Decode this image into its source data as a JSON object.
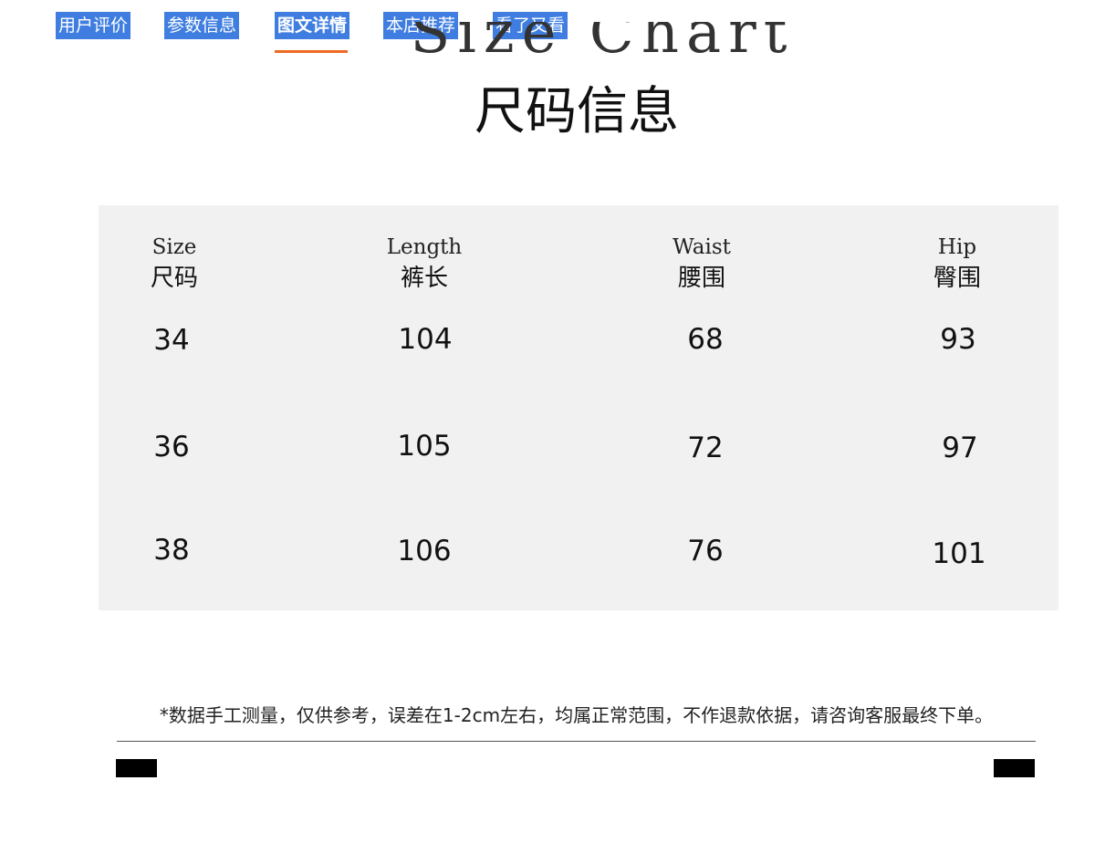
{
  "tabs": [
    {
      "label": "用户评价",
      "active": false
    },
    {
      "label": "参数信息",
      "active": false
    },
    {
      "label": "图文详情",
      "active": true
    },
    {
      "label": "本店推荐",
      "active": false
    },
    {
      "label": "看了又看",
      "active": false
    }
  ],
  "colors": {
    "tab_background": "#3f7ee0",
    "tab_text": "#ffffff",
    "active_underline": "#ef6a22",
    "chart_background": "#f1f1f1"
  },
  "heading": {
    "english": "Size Chart",
    "chinese": "尺码信息"
  },
  "size_table": {
    "columns": [
      {
        "en": "Size",
        "cn": "尺码"
      },
      {
        "en": "Length",
        "cn": "裤长"
      },
      {
        "en": "Waist",
        "cn": "腰围"
      },
      {
        "en": "Hip",
        "cn": "臀围"
      }
    ],
    "rows": [
      [
        "34",
        "104",
        "68",
        "93"
      ],
      [
        "36",
        "105",
        "72",
        "97"
      ],
      [
        "38",
        "106",
        "76",
        "101"
      ]
    ]
  },
  "note": "*数据手工测量，仅供参考，误差在1-2cm左右，均属正常范围，不作退款依据，请咨询客服最终下单。"
}
